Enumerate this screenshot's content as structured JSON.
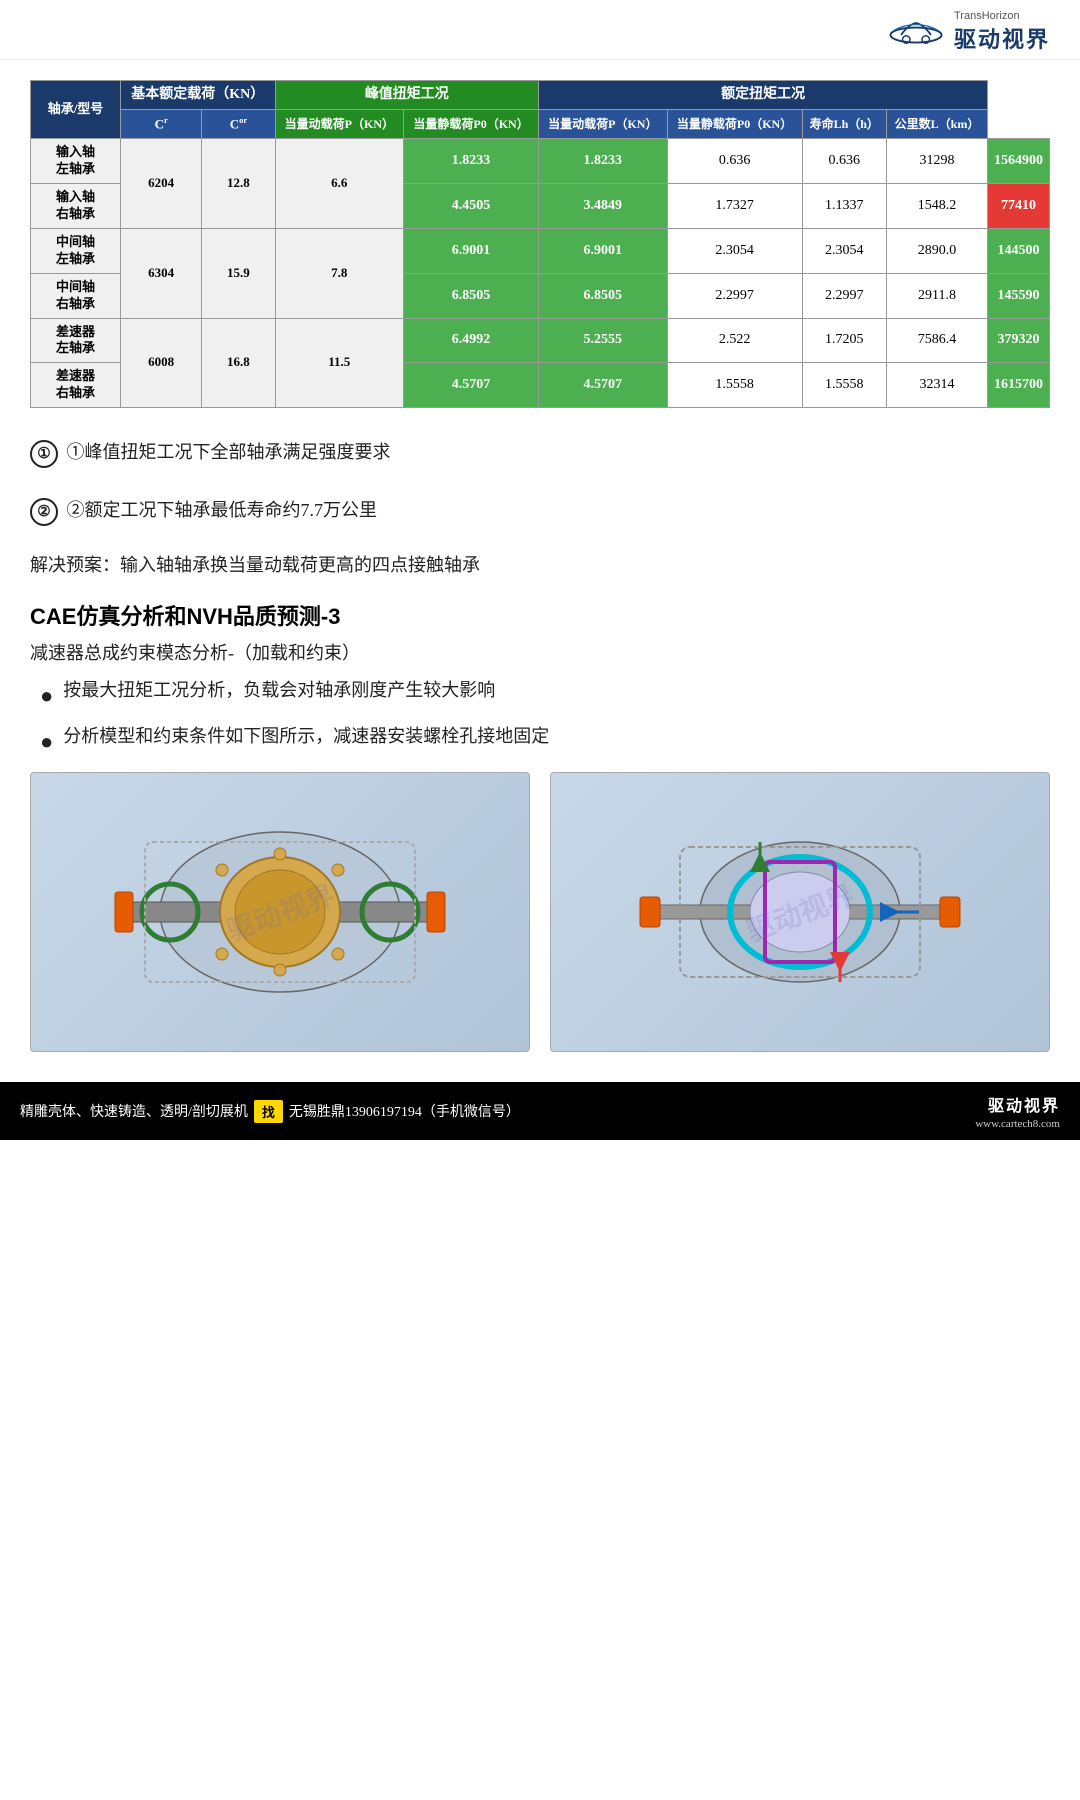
{
  "header": {
    "logo_alt": "TransHorizon",
    "logo_sub": "TransHorizon",
    "brand": "驱动视界"
  },
  "table": {
    "headers": {
      "bearing_label": "轴承/型号",
      "basic_load": "基本额定载荷（KN）",
      "cr": "Cr",
      "cor": "Cor",
      "peak_torque": "峰值扭矩工况",
      "rated_torque": "额定扭矩工况",
      "peak_cols": [
        "当量动载荷P（KN）",
        "当量静载荷P0（KN）",
        "当量动载荷P（KN）",
        "当量静载荷P0（KN）"
      ],
      "rated_cols": [
        "当量动载荷P（KN）",
        "当量静载荷P0（KN）",
        "寿命Lh（h）",
        "公里数L（km）"
      ]
    },
    "rows": [
      {
        "name1": "输入轴左轴承",
        "name2": "输入轴右轴承",
        "model": "6204",
        "cr": "12.8",
        "cor": "6.6",
        "peak_dyn1": "1.8233",
        "peak_sta1": "1.8233",
        "peak_dyn2": "4.4505",
        "peak_sta2": "3.4849",
        "rated_dyn1": "0.636",
        "rated_sta1": "0.636",
        "rated_dyn2": "1.7327",
        "rated_sta2": "1.1337",
        "life1": "31298",
        "km1": "1564900",
        "life2": "1548.2",
        "km2": "77410",
        "km2_highlight": "red"
      },
      {
        "name1": "中间轴左轴承",
        "name2": "中间轴右轴承",
        "model": "6304",
        "cr": "15.9",
        "cor": "7.8",
        "peak_dyn1": "6.9001",
        "peak_sta1": "6.9001",
        "peak_dyn2": "6.8505",
        "peak_sta2": "6.8505",
        "rated_dyn1": "2.3054",
        "rated_sta1": "2.3054",
        "rated_dyn2": "2.2997",
        "rated_sta2": "2.2997",
        "life1": "2890.0",
        "km1": "144500",
        "life2": "2911.8",
        "km2": "145590",
        "km2_highlight": "green"
      },
      {
        "name1": "差速器左轴承",
        "name2": "差速器右轴承",
        "model": "6008",
        "cr": "16.8",
        "cor": "11.5",
        "peak_dyn1": "6.4992",
        "peak_sta1": "5.2555",
        "peak_dyn2": "4.5707",
        "peak_sta2": "4.5707",
        "rated_dyn1": "2.522",
        "rated_sta1": "1.7205",
        "rated_dyn2": "1.5558",
        "rated_sta2": "1.5558",
        "life1": "7586.4",
        "km1": "379320",
        "life2": "32314",
        "km2": "1615700",
        "km2_highlight": "green"
      }
    ]
  },
  "notes": [
    "①峰值扭矩工况下全部轴承满足强度要求",
    "②额定工况下轴承最低寿命约7.7万公里"
  ],
  "resolve": "解决预案：输入轴轴承换当量动载荷更高的四点接触轴承",
  "section_title": "CAE仿真分析和NVH品质预测-3",
  "sub_title": "减速器总成约束模态分析-（加载和约束）",
  "bullets": [
    "按最大扭矩工况分析，负载会对轴承刚度产生较大影响",
    "分析模型和约束条件如下图所示，减速器安装螺栓孔接地固定"
  ],
  "footer": {
    "services": "精雕壳体、快速铸造、透明/剖切展机",
    "tag": "找",
    "contact": "无锡胜鼎13906197194（手机微信号）",
    "brand": "驱动视界",
    "url": "www.cartech8.com"
  }
}
